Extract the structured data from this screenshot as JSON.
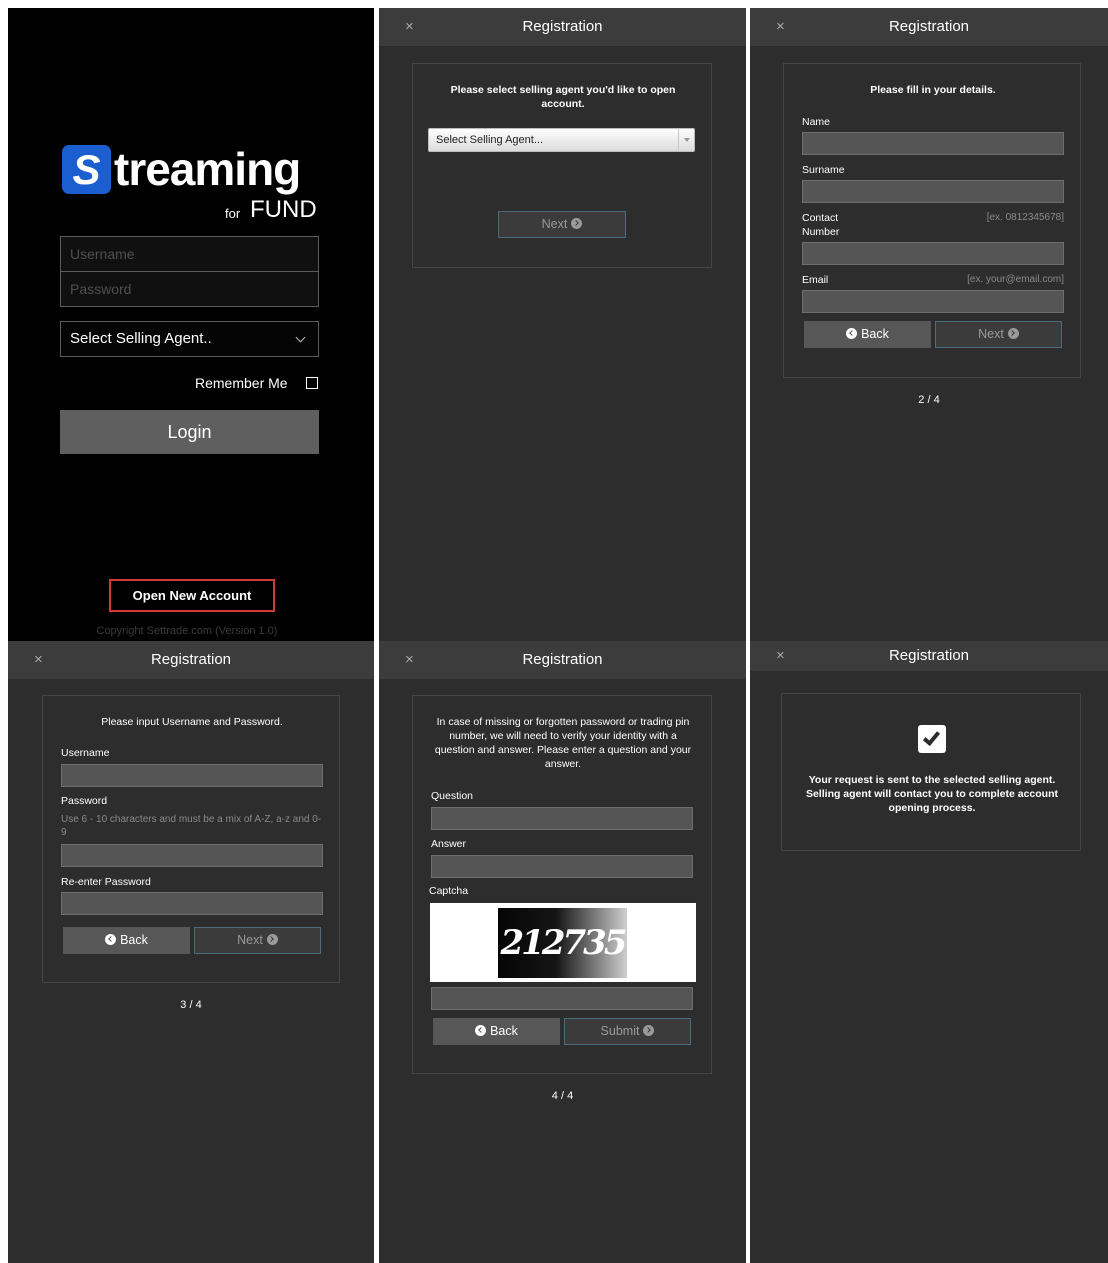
{
  "login": {
    "logo_icon_letter": "S",
    "logo_word": "treaming",
    "logo_for": "for",
    "logo_fund": "FUND",
    "username_placeholder": "Username",
    "password_placeholder": "Password",
    "selling_agent_selected": "Select Selling Agent..",
    "remember_me": "Remember Me",
    "remember_checked": false,
    "login_label": "Login",
    "open_account_label": "Open New Account",
    "copyright": "Copyright Settrade.com (Version 1.0)"
  },
  "registration_header": {
    "close": "×",
    "title": "Registration"
  },
  "buttons": {
    "back": "Back",
    "next": "Next",
    "submit": "Submit"
  },
  "step1": {
    "instruction": "Please select selling agent you'd like to open account.",
    "select_placeholder": "Select Selling Agent..."
  },
  "step2": {
    "instruction": "Please fill in your details.",
    "name_label": "Name",
    "surname_label": "Surname",
    "contact_label": "Contact Number",
    "contact_hint": "[ex. 0812345678]",
    "email_label": "Email",
    "email_hint": "[ex. your@email.com]",
    "page": "2 / 4"
  },
  "step3": {
    "instruction": "Please input Username and Password.",
    "username_label": "Username",
    "password_label": "Password",
    "password_hint": "Use 6 - 10 characters and must be a mix of A-Z, a-z and 0-9",
    "reenter_label": "Re-enter Password",
    "page": "3 / 4"
  },
  "step4": {
    "instruction": "In case of missing or forgotten password or trading pin number, we will need to verify your identity with a question and answer. Please enter a question and your answer.",
    "question_label": "Question",
    "answer_label": "Answer",
    "captcha_label": "Captcha",
    "captcha_code": "212735",
    "page": "4 / 4"
  },
  "done": {
    "message": "Your request is sent to the selected selling agent. Selling agent will contact you to complete account opening process."
  },
  "colors": {
    "panel_bg": "#2d2d2d",
    "header_bg": "#3c3c3c",
    "login_bg": "#000000",
    "brand_blue": "#1a5ecf",
    "highlight_red": "#d33a3a"
  }
}
